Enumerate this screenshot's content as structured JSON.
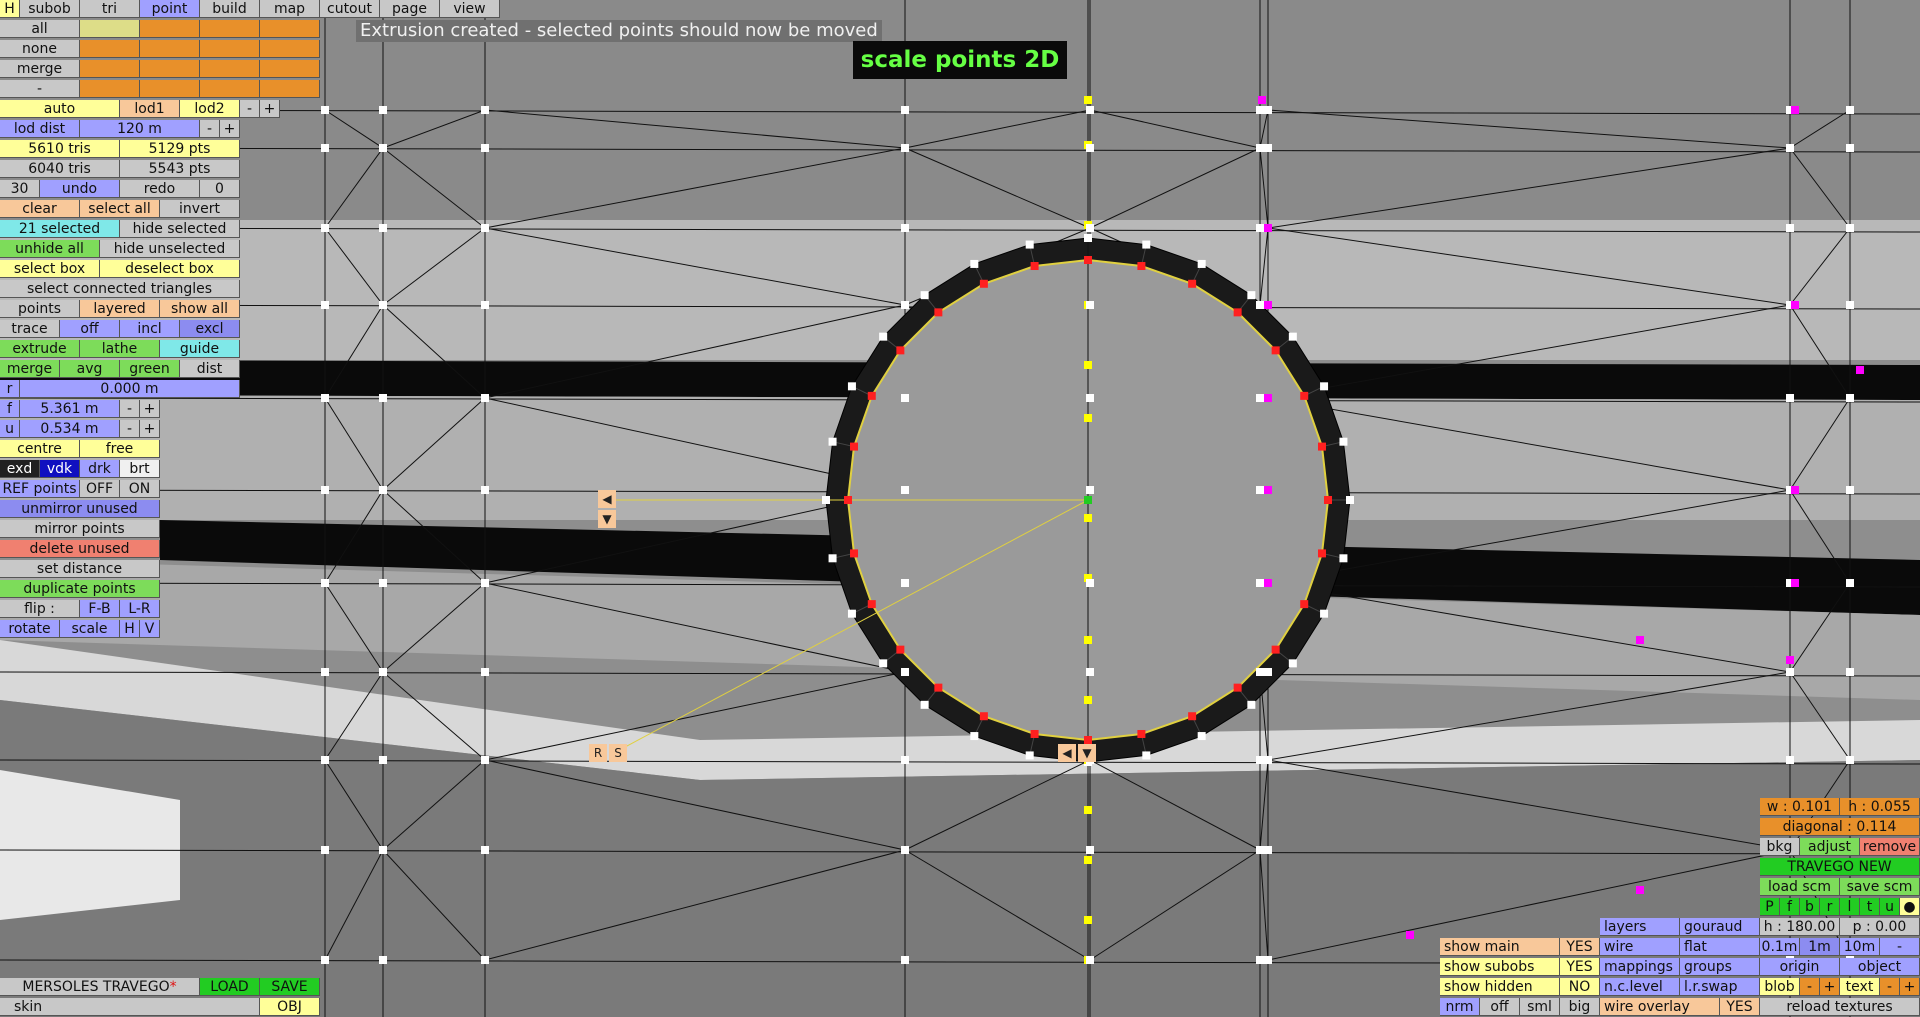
{
  "status_message": "Extrusion created - selected points should now be moved",
  "mode_label": "scale points 2D",
  "colors": {
    "selected_point": "#ff2020",
    "mirror_point": "#ff00ff",
    "centre_point": "#ffff00",
    "guide_line": "#e0d040",
    "mode_text": "#66ff44"
  },
  "menu": {
    "h": "H",
    "subob": "subob",
    "tri": "tri",
    "point": "point",
    "build": "build",
    "map": "map",
    "cutout": "cutout",
    "page": "page",
    "view": "view"
  },
  "groups": {
    "all": "all",
    "none": "none",
    "merge": "merge",
    "minus": "-"
  },
  "lod": {
    "auto": "auto",
    "lod1": "lod1",
    "lod2": "lod2",
    "minus": "-",
    "plus": "+",
    "dist_label": "lod dist",
    "dist_value": "120 m"
  },
  "stats": {
    "tris_a": "5610 tris",
    "pts_a": "5129 pts",
    "tris_b": "6040 tris",
    "pts_b": "5543 pts"
  },
  "history": {
    "count": "30",
    "undo": "undo",
    "redo": "redo",
    "redo_count": "0"
  },
  "selection": {
    "clear": "clear",
    "select_all": "select all",
    "invert": "invert",
    "selected": "21 selected",
    "hide_selected": "hide selected",
    "unhide_all": "unhide all",
    "hide_unselected": "hide unselected",
    "select_box": "select box",
    "deselect_box": "deselect box",
    "select_connected": "select connected triangles"
  },
  "points_row": {
    "points": "points",
    "layered": "layered",
    "show_all": "show all"
  },
  "trace": {
    "label": "trace",
    "off": "off",
    "incl": "incl",
    "excl": "excl"
  },
  "tools": {
    "extrude": "extrude",
    "lathe": "lathe",
    "guide": "guide",
    "merge": "merge",
    "avg": "avg",
    "green": "green",
    "dist": "dist"
  },
  "params": {
    "r_label": "r",
    "r_value": "0.000 m",
    "f_label": "f",
    "f_value": "5.361 m",
    "u_label": "u",
    "u_value": "0.534 m",
    "minus": "-",
    "plus": "+"
  },
  "centre": {
    "centre": "centre",
    "free": "free"
  },
  "shading": {
    "exd": "exd",
    "vdk": "vdk",
    "drk": "drk",
    "brt": "brt"
  },
  "ref": {
    "label": "REF points",
    "off": "OFF",
    "on": "ON"
  },
  "actions": {
    "unmirror": "unmirror unused",
    "mirror": "mirror points",
    "delete": "delete unused",
    "set_distance": "set distance",
    "duplicate": "duplicate points"
  },
  "flip": {
    "label": "flip :",
    "fb": "F-B",
    "lr": "L-R"
  },
  "transform": {
    "rotate": "rotate",
    "scale": "scale",
    "h": "H",
    "v": "V"
  },
  "file": {
    "name": "MERSOLES TRAVEGO",
    "modified_mark": "*",
    "load": "LOAD",
    "save": "SAVE",
    "skin": "skin",
    "obj": "OBJ"
  },
  "handles": {
    "left": "◀",
    "down": "▼",
    "r": "R",
    "s": "S"
  },
  "show_panel": {
    "main": "show main",
    "main_val": "YES",
    "subobs": "show subobs",
    "subobs_val": "YES",
    "hidden": "show hidden",
    "hidden_val": "NO",
    "nrm": "nrm",
    "off": "off",
    "sml": "sml",
    "big": "big"
  },
  "render_panel": {
    "layers": "layers",
    "gouraud": "gouraud",
    "wire": "wire",
    "flat": "flat",
    "mappings": "mappings",
    "groups": "groups",
    "nc_level": "n.c.level",
    "lr_swap": "l.r.swap",
    "wire_overlay": "wire overlay",
    "wire_overlay_val": "YES"
  },
  "right_panel": {
    "w": "w : 0.101",
    "h": "h : 0.055",
    "diagonal": "diagonal : 0.114",
    "bkg": "bkg",
    "adjust": "adjust",
    "remove": "remove",
    "scm_name": "TRAVEGO NEW",
    "load_scm": "load scm",
    "save_scm": "save scm",
    "views": [
      "P",
      "f",
      "b",
      "r",
      "l",
      "t",
      "u"
    ],
    "heading": "h : 180.00",
    "pitch": "p : 0.00",
    "s01": "0.1m",
    "s1": "1m",
    "s10": "10m",
    "sminus": "-",
    "origin": "origin",
    "object": "object",
    "blob": "blob",
    "bminus": "-",
    "bplus": "+",
    "text": "text",
    "tminus": "-",
    "tplus": "+",
    "reload": "reload textures"
  }
}
